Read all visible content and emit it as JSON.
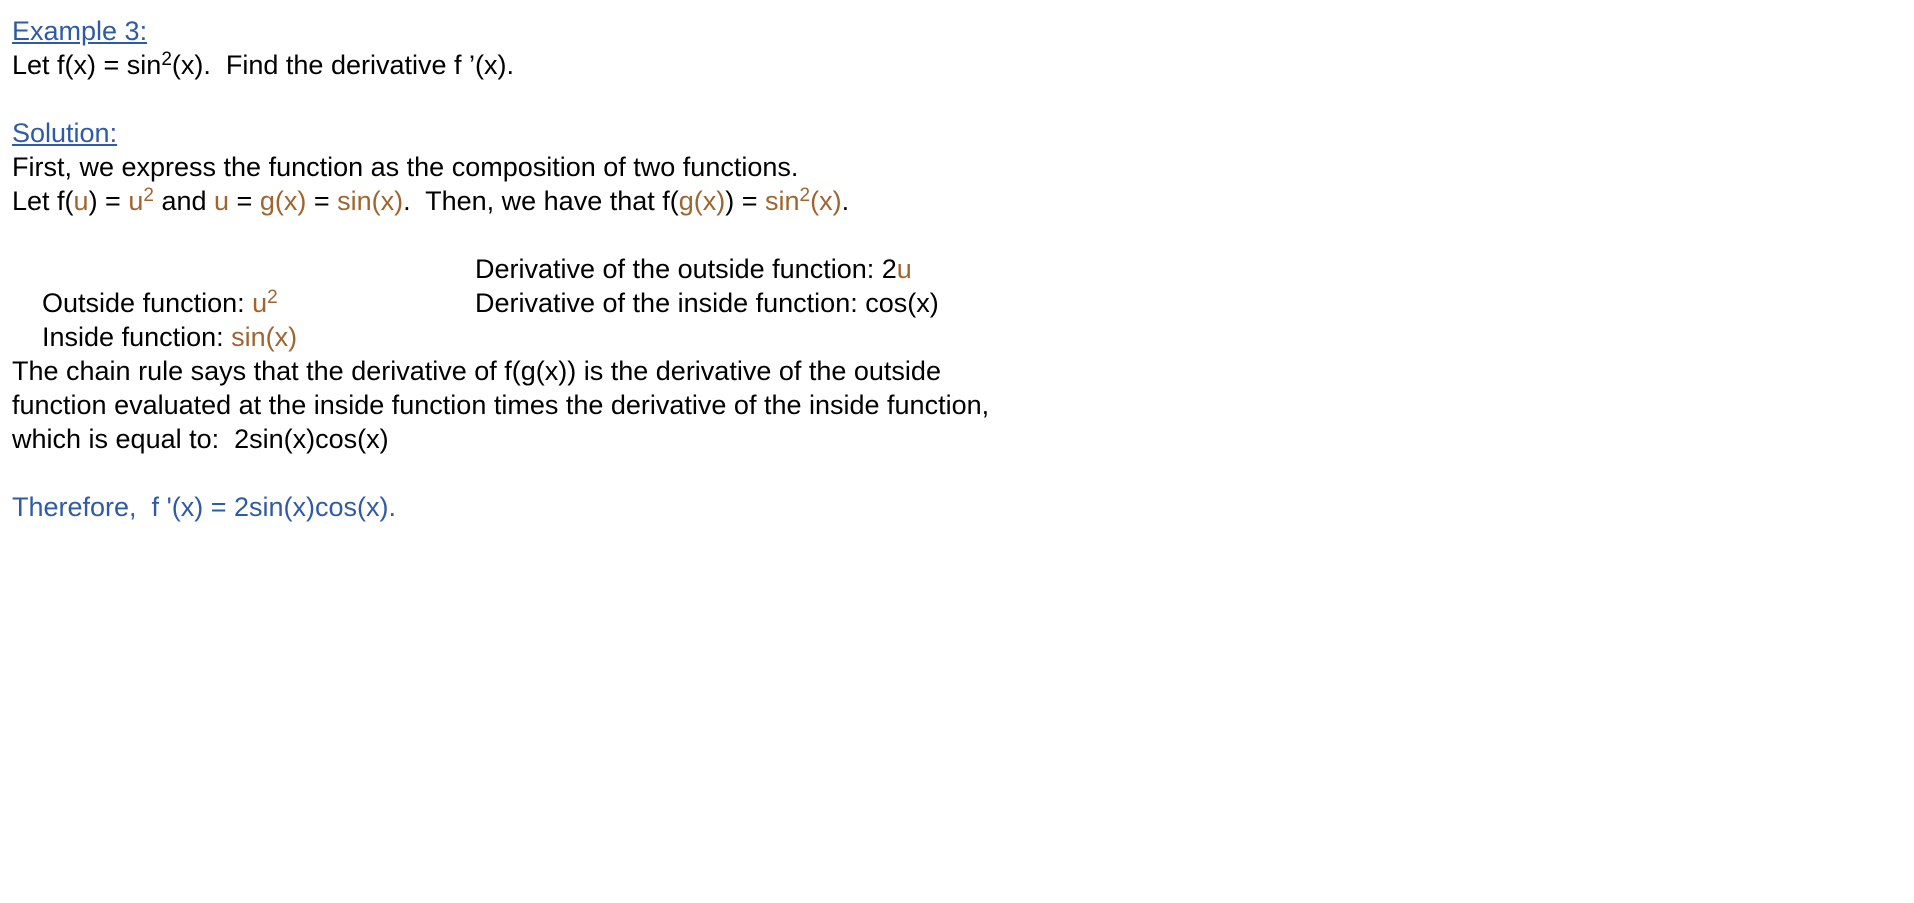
{
  "example": {
    "heading": "Example 3:",
    "problem": {
      "p1": "Let f(x) = sin",
      "sup": "2",
      "p2": "(x).  Find the derivative f ’(x)."
    }
  },
  "solution": {
    "heading": "Solution:",
    "intro": "First, we express the function as the composition of two functions.",
    "let_line": {
      "a": "Let f(",
      "u1": "u",
      "b": ") = ",
      "u2": "u",
      "sup1": "2",
      "c": " and ",
      "u3": "u",
      "d": " = ",
      "gx": "g(x)",
      "e": " = ",
      "sinx": "sin(x)",
      "f": ".  Then, we have that f(",
      "gx2": "g(x)",
      "g": ") = ",
      "sin2a": "sin",
      "sup2": "2",
      "sin2b": "(x)",
      "h": "."
    },
    "outside": {
      "label": "Outside function: ",
      "value": "u",
      "sup": "2",
      "deriv_label": "Derivative of the outside function: 2",
      "deriv_value": "u"
    },
    "inside": {
      "label": "Inside function: ",
      "value": "sin(x)",
      "deriv_label": "Derivative of the inside function: cos(x)"
    },
    "chain_rule": [
      "The chain rule says that the derivative of f(g(x)) is the derivative of the outside",
      "function evaluated at the inside function times the derivative of the inside function,",
      "which is equal to:  2sin(x)cos(x)"
    ],
    "conclusion": "Therefore,  f '(x) = 2sin(x)cos(x)."
  },
  "colors": {
    "heading": "#2e5aa8",
    "highlight": "#a0652e",
    "text": "#000000"
  }
}
